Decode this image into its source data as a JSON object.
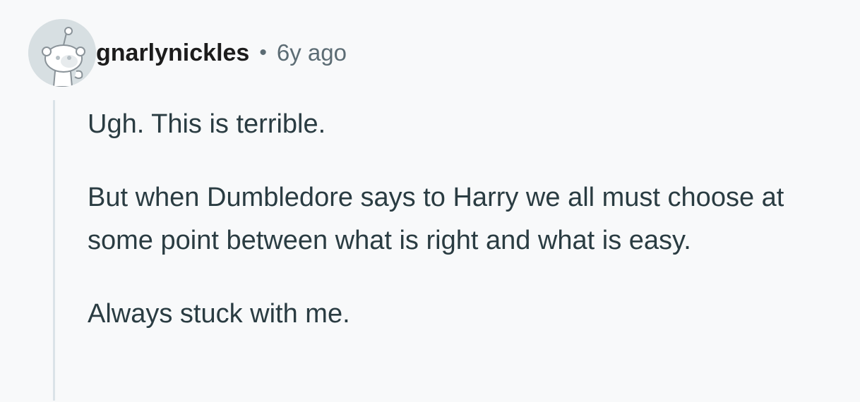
{
  "comment": {
    "author": "gnarlynickles",
    "separator": "•",
    "timestamp": "6y ago",
    "paragraphs": [
      "Ugh. This is terrible.",
      "But when Dumbledore says to Harry we all must choose at some point between what is right and what is easy.",
      "Always stuck with me."
    ]
  },
  "colors": {
    "background": "#f8f9fa",
    "text": "#2a3c42",
    "username": "#1c1c1c",
    "meta": "#5c6c74",
    "thread_line": "#dbe3e8"
  },
  "icons": {
    "avatar": "default-snoo-avatar"
  }
}
